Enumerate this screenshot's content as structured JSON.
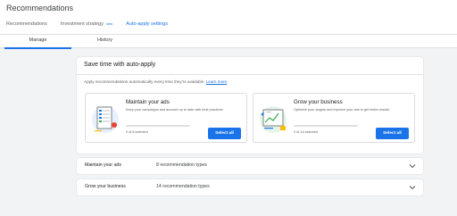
{
  "header": {
    "title": "Recommendations"
  },
  "tabs": [
    {
      "label": "Recommendations"
    },
    {
      "label": "Investment strategy",
      "badge": "new"
    },
    {
      "label": "Auto-apply settings"
    }
  ],
  "subtabs": [
    {
      "label": "Manage"
    },
    {
      "label": "History"
    }
  ],
  "auto_apply": {
    "title": "Save time with auto-apply",
    "description": "Apply recommendations automatically every time they're available.",
    "learn_more": "Learn more",
    "cards": [
      {
        "title": "Maintain your ads",
        "description": "Keep your campaigns and account up to date with best practices",
        "selected_text": "0 of 8 selected",
        "progress": 0,
        "button": "Select all",
        "icon": "ads-maintenance-illustration"
      },
      {
        "title": "Grow your business",
        "description": "Optimize your targets and improve your ads to get better results",
        "selected_text": "0 of 14 selected",
        "progress": 0,
        "button": "Select all",
        "icon": "growth-chart-illustration"
      }
    ]
  },
  "sections": [
    {
      "name": "Maintain your ads",
      "count": "8 recommendation types"
    },
    {
      "name": "Grow your business",
      "count": "14 recommendation types"
    }
  ],
  "colors": {
    "accent": "#1a73e8",
    "background": "#f1f3f4"
  }
}
